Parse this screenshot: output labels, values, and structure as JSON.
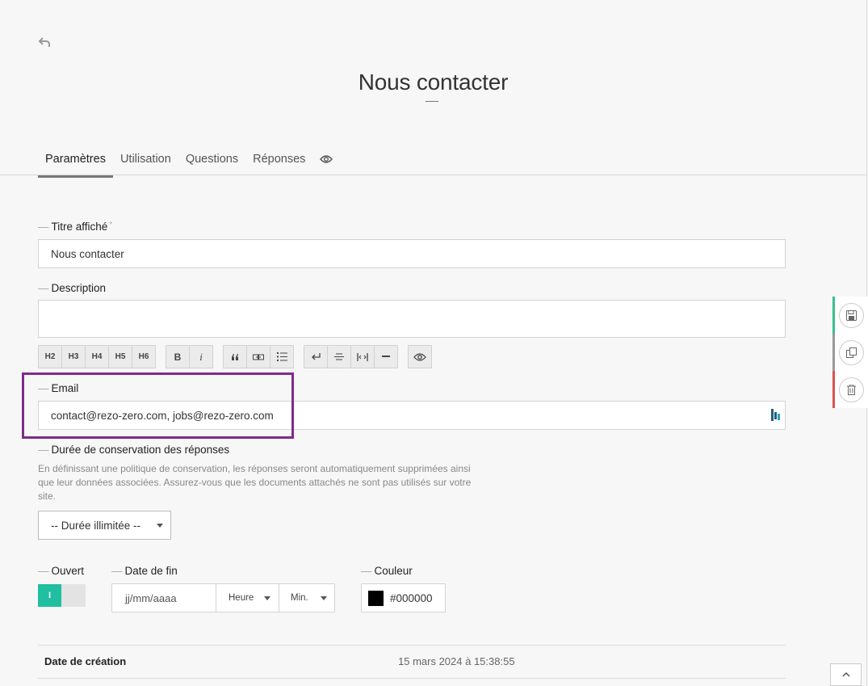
{
  "page": {
    "title": "Nous contacter"
  },
  "tabs": [
    {
      "label": "Paramètres",
      "active": true
    },
    {
      "label": "Utilisation",
      "active": false
    },
    {
      "label": "Questions",
      "active": false
    },
    {
      "label": "Réponses",
      "active": false
    }
  ],
  "fields": {
    "title": {
      "label": "Titre affiché",
      "required_mark": "*",
      "value": "Nous contacter"
    },
    "description": {
      "label": "Description",
      "value": ""
    },
    "email": {
      "label": "Email",
      "value": "contact@rezo-zero.com, jobs@rezo-zero.com"
    },
    "retention": {
      "label": "Durée de conservation des réponses",
      "help": "En définissant une politique de conservation, les réponses seront automatiquement supprimées ainsi que leur données associées. Assurez-vous que les documents attachés ne sont pas utilisés sur votre site.",
      "selected": "-- Durée illimitée --"
    },
    "open": {
      "label": "Ouvert",
      "toggle_text": "I",
      "value": true
    },
    "end_date": {
      "label": "Date de fin",
      "date_placeholder": "jj/mm/aaaa",
      "hour_label": "Heure",
      "minute_label": "Min."
    },
    "color": {
      "label": "Couleur",
      "value": "#000000"
    }
  },
  "toolbar": {
    "headings": [
      "H2",
      "H3",
      "H4",
      "H5",
      "H6"
    ],
    "format": [
      "B",
      "i"
    ]
  },
  "info": {
    "created_label": "Date de création",
    "created_value": "15 mars 2024 à 15:38:55"
  },
  "colors": {
    "accent_green": "#1fbf9f",
    "highlight": "#7f2a8c",
    "delete_red": "#d9534f",
    "save_green": "#3bbf8f"
  }
}
